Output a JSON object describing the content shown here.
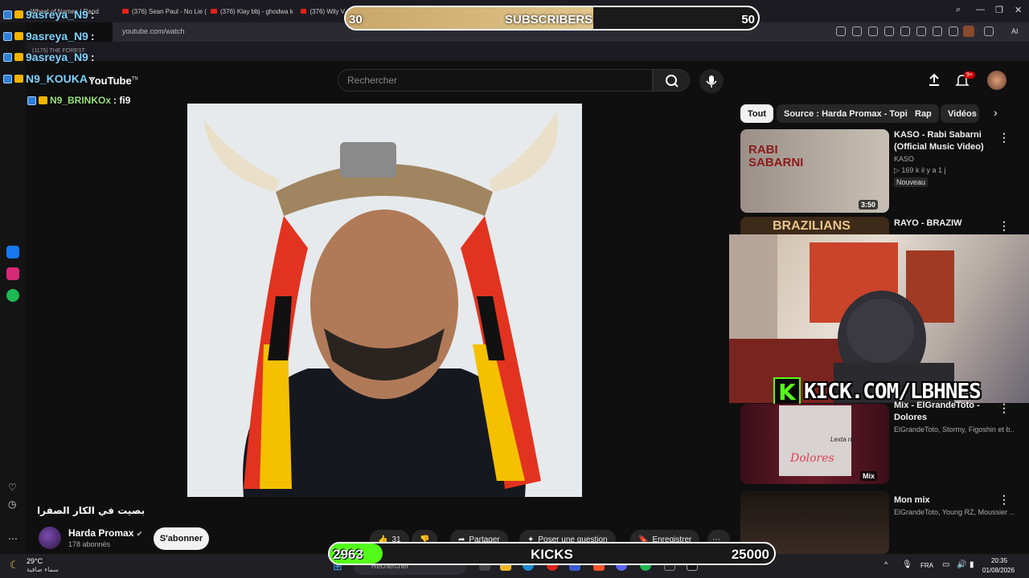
{
  "browser": {
    "tabs": [
      "Wheel of Names | Rand",
      "(376) Sean Paul - No Lie (",
      "(376) Klay bbj - ghodwa k",
      "(376) Wily V"
    ],
    "extra_tab": "(1175) THE FOREST",
    "url": "youtube.com/watch",
    "ai_label": "AI"
  },
  "youtube": {
    "logo": "YouTube",
    "logo_sup": "TN",
    "search_placeholder": "Rechercher",
    "notif_count": "9+",
    "chips": [
      "Tout",
      "Source : Harda Promax - Topic",
      "Rap",
      "Vidéos s"
    ],
    "video_title": "بصيت في الكار الصفرا",
    "channel_name": "Harda Promax",
    "channel_subs": "178 abonnés",
    "subscribe_label": "S'abonner",
    "like_count": "31",
    "share_label": "Partager",
    "ask_label": "Poser une question",
    "save_label": "Enregistrer",
    "recommendations": [
      {
        "title": "KASO - Rabi Sabarni (Official Music Video)",
        "channel": "KASO",
        "meta": "▷ 169 k   il y a 1 j",
        "badge": "Nouveau",
        "duration": "3:50",
        "thumb_text": "RABI SABARNI"
      },
      {
        "title": "RAYO - BRAZIW",
        "channel": "",
        "meta": "",
        "badge": "",
        "duration": "",
        "thumb_text": "BRAZILIANS"
      },
      {
        "title": "Mix - ElGrandeToto - Dolores",
        "channel": "ElGrandeToto, Stormy, Figoshin et b...",
        "meta": "",
        "badge": "",
        "duration": "Mix",
        "thumb_text": "Dolores"
      },
      {
        "title": "Mon mix",
        "channel": "ElGrandeToto, Young RZ, Moussier ...",
        "meta": "",
        "badge": "",
        "duration": "",
        "thumb_text": ""
      }
    ],
    "thumb_sub_text": "Lexta rm"
  },
  "overlay": {
    "chat": [
      {
        "user": "9asreya_N9",
        "msg": ":"
      },
      {
        "user": "9asreya_N9",
        "msg": ":"
      },
      {
        "user": "9asreya_N9",
        "msg": ":"
      },
      {
        "user": "N9_KOUKA",
        "msg": ":"
      },
      {
        "user": "N9_BRINKOx",
        "msg": ": fi9"
      }
    ],
    "subs_goal": {
      "current": "30",
      "label": "SUBSCRIBERS",
      "target": "50",
      "progress": 0.6
    },
    "kicks_goal": {
      "current": "2963",
      "label": "KICKS",
      "target": "25000",
      "progress": 0.12
    },
    "kick_url": "KICK.COM/LBHNES",
    "kick_logo": "K"
  },
  "taskbar": {
    "temp": "29°C",
    "weather": "سماء صافية",
    "search_placeholder": "Rechercher",
    "lang": "FRA",
    "time": "20:35",
    "date": "01/08/2026"
  },
  "colors": {
    "kick_green": "#53fc18",
    "yt_bg": "#0f0f0f",
    "chat_name": "#7fd4ff"
  }
}
